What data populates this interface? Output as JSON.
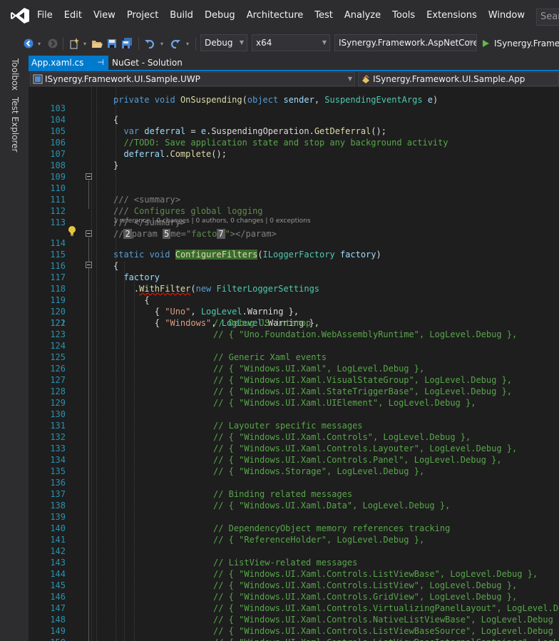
{
  "menu": {
    "items": [
      "File",
      "Edit",
      "View",
      "Project",
      "Build",
      "Debug",
      "Architecture",
      "Test",
      "Analyze",
      "Tools",
      "Extensions",
      "Window",
      "Help"
    ],
    "search_placeholder": "Search"
  },
  "toolbar": {
    "configuration": "Debug",
    "platform": "x64",
    "startup_project": "ISynergy.Framework.AspNetCore (I",
    "run_target": "ISynergy.Framew"
  },
  "side_tabs": [
    "Toolbox",
    "Test Explorer"
  ],
  "doc_tabs": [
    {
      "label": "App.xaml.cs",
      "active": true,
      "pin": "⊣"
    },
    {
      "label": "NuGet - Solution",
      "active": false
    }
  ],
  "navbar": {
    "project": "ISynergy.Framework.UI.Sample.UWP",
    "type": "ISynergy.Framework.UI.Sample.App"
  },
  "codelens": "1 reference | 0 changes | 0 authors, 0 changes | 0 exceptions",
  "overlay_badges": [
    "2",
    "5",
    "7"
  ],
  "editor": {
    "lines": [
      {
        "n": "",
        "t": "private void OnSuspending(object sender, SuspendingEventArgs e)"
      },
      {
        "n": "103",
        "t": "{"
      },
      {
        "n": "104",
        "t": "var deferral = e.SuspendingOperation.GetDeferral();"
      },
      {
        "n": "105",
        "t": "//TODO: Save application state and stop any background activity"
      },
      {
        "n": "106",
        "t": "deferral.Complete();"
      },
      {
        "n": "107",
        "t": "}"
      },
      {
        "n": "108",
        "t": ""
      },
      {
        "n": "109",
        "t": ""
      },
      {
        "n": "110",
        "t": "/// <summary>"
      },
      {
        "n": "111",
        "t": "/// Configures global logging"
      },
      {
        "n": "112",
        "t": "/// </summary>"
      },
      {
        "n": "113",
        "t": "/// <param name=\"factory\"></param>"
      },
      {
        "n": "114",
        "t": "static void ConfigureFilters(ILoggerFactory factory)"
      },
      {
        "n": "115",
        "t": "{"
      },
      {
        "n": "116",
        "t": "factory"
      },
      {
        "n": "117",
        "t": ".WithFilter(new FilterLoggerSettings"
      },
      {
        "n": "118",
        "t": "{"
      },
      {
        "n": "119",
        "t": "{ \"Uno\", LogLevel.Warning },"
      },
      {
        "n": "120",
        "t": "{ \"Windows\", LogLevel.Warning },"
      },
      {
        "n": "121",
        "t": ""
      },
      {
        "n": "122",
        "t": "// Debug JS interop"
      },
      {
        "n": "123",
        "t": "// { \"Uno.Foundation.WebAssemblyRuntime\", LogLevel.Debug },"
      },
      {
        "n": "124",
        "t": ""
      },
      {
        "n": "125",
        "t": "// Generic Xaml events"
      },
      {
        "n": "126",
        "t": "// { \"Windows.UI.Xaml\", LogLevel.Debug },"
      },
      {
        "n": "127",
        "t": "// { \"Windows.UI.Xaml.VisualStateGroup\", LogLevel.Debug },"
      },
      {
        "n": "128",
        "t": "// { \"Windows.UI.Xaml.StateTriggerBase\", LogLevel.Debug },"
      },
      {
        "n": "129",
        "t": "// { \"Windows.UI.Xaml.UIElement\", LogLevel.Debug },"
      },
      {
        "n": "130",
        "t": ""
      },
      {
        "n": "131",
        "t": "// Layouter specific messages"
      },
      {
        "n": "132",
        "t": "// { \"Windows.UI.Xaml.Controls\", LogLevel.Debug },"
      },
      {
        "n": "133",
        "t": "// { \"Windows.UI.Xaml.Controls.Layouter\", LogLevel.Debug },"
      },
      {
        "n": "134",
        "t": "// { \"Windows.UI.Xaml.Controls.Panel\", LogLevel.Debug },"
      },
      {
        "n": "135",
        "t": "// { \"Windows.Storage\", LogLevel.Debug },"
      },
      {
        "n": "136",
        "t": ""
      },
      {
        "n": "137",
        "t": "// Binding related messages"
      },
      {
        "n": "138",
        "t": "// { \"Windows.UI.Xaml.Data\", LogLevel.Debug },"
      },
      {
        "n": "139",
        "t": ""
      },
      {
        "n": "140",
        "t": "// DependencyObject memory references tracking"
      },
      {
        "n": "141",
        "t": "// { \"ReferenceHolder\", LogLevel.Debug },"
      },
      {
        "n": "142",
        "t": ""
      },
      {
        "n": "143",
        "t": "// ListView-related messages"
      },
      {
        "n": "144",
        "t": "// { \"Windows.UI.Xaml.Controls.ListViewBase\", LogLevel.Debug },"
      },
      {
        "n": "145",
        "t": "// { \"Windows.UI.Xaml.Controls.ListView\", LogLevel.Debug },"
      },
      {
        "n": "146",
        "t": "// { \"Windows.UI.Xaml.Controls.GridView\", LogLevel.Debug },"
      },
      {
        "n": "147",
        "t": "// { \"Windows.UI.Xaml.Controls.VirtualizingPanelLayout\", LogLevel.Debug },"
      },
      {
        "n": "148",
        "t": "// { \"Windows.UI.Xaml.Controls.NativeListViewBase\", LogLevel.Debug },"
      },
      {
        "n": "149",
        "t": "// { \"Windows.UI.Xaml.Controls.ListViewBaseSource\", LogLevel.Debug },"
      },
      {
        "n": "150",
        "t": "// { \"Windows.UI.Xaml.Controls.ListViewBaseInternalContainer\", LogLevel.Debug },"
      }
    ]
  },
  "colors": {
    "accent": "#007acc",
    "chrome": "#2d2d30",
    "editor_bg": "#1e1e1e",
    "line_number": "#2b91af",
    "keyword": "#569cd6",
    "type": "#4ec9b0",
    "string": "#d69d85",
    "comment": "#57a64a",
    "method_highlight": "#3a6b2f"
  }
}
